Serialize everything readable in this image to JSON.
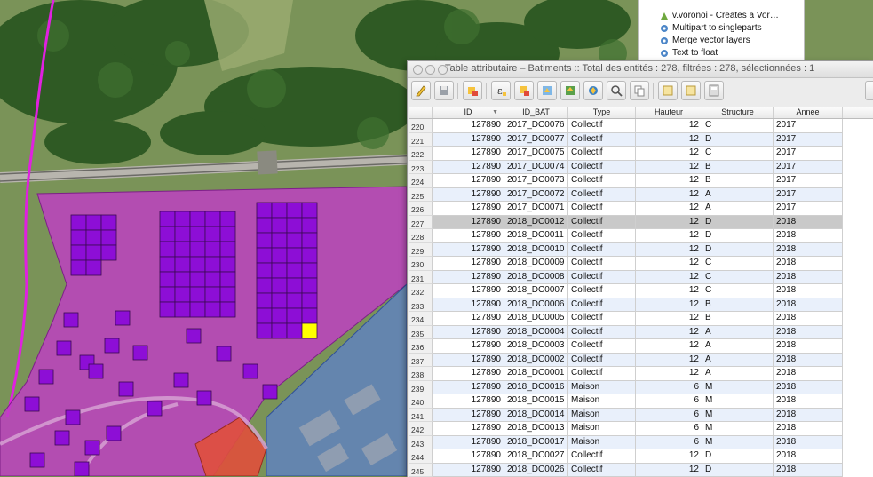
{
  "toolbox": {
    "items": [
      {
        "label": "v.voronoi - Creates a Vor…",
        "icon": "grass-icon"
      },
      {
        "label": "Multipart to singleparts",
        "icon": "gear-icon"
      },
      {
        "label": "Merge vector layers",
        "icon": "gear-icon"
      },
      {
        "label": "Text to float",
        "icon": "gear-icon"
      }
    ]
  },
  "window": {
    "title": "Table attributaire – Batiments :: Total des entités : 278, filtrées : 278, sélectionnées : 1"
  },
  "toolbar": {
    "icons": [
      "pencil-icon",
      "save-icon",
      "delete-selected-icon",
      "expression-select-icon",
      "select-all-icon",
      "invert-selection-icon",
      "move-selection-top-icon",
      "pan-to-selection-icon",
      "zoom-to-selection-icon",
      "search-icon",
      "copy-icon",
      "new-field-icon",
      "delete-field-icon",
      "field-calculator-icon"
    ]
  },
  "table": {
    "columns": [
      "ID",
      "ID_BAT",
      "Type",
      "Hauteur",
      "Structure",
      "Annee"
    ],
    "sort_indicator": "▼",
    "selected_row": "227",
    "rows": [
      {
        "n": "220",
        "id": "127890",
        "bat": "2017_DC0076",
        "type": "Collectif",
        "h": "12",
        "s": "C",
        "a": "2017"
      },
      {
        "n": "221",
        "id": "127890",
        "bat": "2017_DC0077",
        "type": "Collectif",
        "h": "12",
        "s": "D",
        "a": "2017"
      },
      {
        "n": "222",
        "id": "127890",
        "bat": "2017_DC0075",
        "type": "Collectif",
        "h": "12",
        "s": "C",
        "a": "2017"
      },
      {
        "n": "223",
        "id": "127890",
        "bat": "2017_DC0074",
        "type": "Collectif",
        "h": "12",
        "s": "B",
        "a": "2017"
      },
      {
        "n": "224",
        "id": "127890",
        "bat": "2017_DC0073",
        "type": "Collectif",
        "h": "12",
        "s": "B",
        "a": "2017"
      },
      {
        "n": "225",
        "id": "127890",
        "bat": "2017_DC0072",
        "type": "Collectif",
        "h": "12",
        "s": "A",
        "a": "2017"
      },
      {
        "n": "226",
        "id": "127890",
        "bat": "2017_DC0071",
        "type": "Collectif",
        "h": "12",
        "s": "A",
        "a": "2017"
      },
      {
        "n": "227",
        "id": "127890",
        "bat": "2018_DC0012",
        "type": "Collectif",
        "h": "12",
        "s": "D",
        "a": "2018"
      },
      {
        "n": "228",
        "id": "127890",
        "bat": "2018_DC0011",
        "type": "Collectif",
        "h": "12",
        "s": "D",
        "a": "2018"
      },
      {
        "n": "229",
        "id": "127890",
        "bat": "2018_DC0010",
        "type": "Collectif",
        "h": "12",
        "s": "D",
        "a": "2018"
      },
      {
        "n": "230",
        "id": "127890",
        "bat": "2018_DC0009",
        "type": "Collectif",
        "h": "12",
        "s": "C",
        "a": "2018"
      },
      {
        "n": "231",
        "id": "127890",
        "bat": "2018_DC0008",
        "type": "Collectif",
        "h": "12",
        "s": "C",
        "a": "2018"
      },
      {
        "n": "232",
        "id": "127890",
        "bat": "2018_DC0007",
        "type": "Collectif",
        "h": "12",
        "s": "C",
        "a": "2018"
      },
      {
        "n": "233",
        "id": "127890",
        "bat": "2018_DC0006",
        "type": "Collectif",
        "h": "12",
        "s": "B",
        "a": "2018"
      },
      {
        "n": "234",
        "id": "127890",
        "bat": "2018_DC0005",
        "type": "Collectif",
        "h": "12",
        "s": "B",
        "a": "2018"
      },
      {
        "n": "235",
        "id": "127890",
        "bat": "2018_DC0004",
        "type": "Collectif",
        "h": "12",
        "s": "A",
        "a": "2018"
      },
      {
        "n": "236",
        "id": "127890",
        "bat": "2018_DC0003",
        "type": "Collectif",
        "h": "12",
        "s": "A",
        "a": "2018"
      },
      {
        "n": "237",
        "id": "127890",
        "bat": "2018_DC0002",
        "type": "Collectif",
        "h": "12",
        "s": "A",
        "a": "2018"
      },
      {
        "n": "238",
        "id": "127890",
        "bat": "2018_DC0001",
        "type": "Collectif",
        "h": "12",
        "s": "A",
        "a": "2018"
      },
      {
        "n": "239",
        "id": "127890",
        "bat": "2018_DC0016",
        "type": "Maison",
        "h": "6",
        "s": "M",
        "a": "2018"
      },
      {
        "n": "240",
        "id": "127890",
        "bat": "2018_DC0015",
        "type": "Maison",
        "h": "6",
        "s": "M",
        "a": "2018"
      },
      {
        "n": "241",
        "id": "127890",
        "bat": "2018_DC0014",
        "type": "Maison",
        "h": "6",
        "s": "M",
        "a": "2018"
      },
      {
        "n": "242",
        "id": "127890",
        "bat": "2018_DC0013",
        "type": "Maison",
        "h": "6",
        "s": "M",
        "a": "2018"
      },
      {
        "n": "243",
        "id": "127890",
        "bat": "2018_DC0017",
        "type": "Maison",
        "h": "6",
        "s": "M",
        "a": "2018"
      },
      {
        "n": "244",
        "id": "127890",
        "bat": "2018_DC0027",
        "type": "Collectif",
        "h": "12",
        "s": "D",
        "a": "2018"
      },
      {
        "n": "245",
        "id": "127890",
        "bat": "2018_DC0026",
        "type": "Collectif",
        "h": "12",
        "s": "D",
        "a": "2018"
      }
    ]
  },
  "colors": {
    "parcel": "#c03ec4",
    "building": "#8d0ed6",
    "selected_building": "#ffff00",
    "blue_zone": "#5b7fd0",
    "red_zone": "#e0503c",
    "boundary": "#e020e0",
    "row_alt": "#e9f0fb",
    "row_selected": "#c9c9c9"
  }
}
